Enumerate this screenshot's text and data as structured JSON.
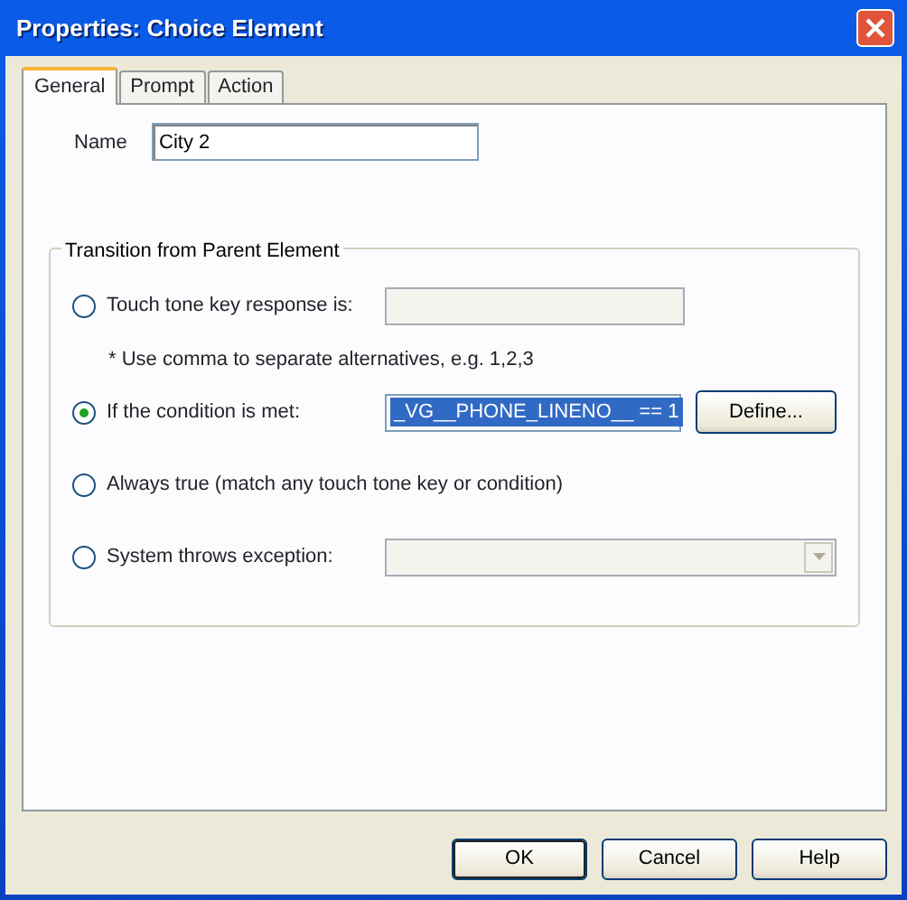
{
  "window": {
    "title": "Properties: Choice Element"
  },
  "tabs": [
    {
      "label": "General",
      "selected": true
    },
    {
      "label": "Prompt",
      "selected": false
    },
    {
      "label": "Action",
      "selected": false
    }
  ],
  "name_field": {
    "label": "Name",
    "value": "City 2"
  },
  "transition_group": {
    "title": "Transition from Parent Element",
    "options": [
      {
        "kind": "text-field",
        "label": "Touch tone key response is:",
        "selected": false,
        "disabled": true,
        "note": "* Use comma to separate alternatives, e.g. 1,2,3"
      },
      {
        "kind": "condition",
        "label": "If the condition is met:",
        "selected": true,
        "value": "_VG__PHONE_LINENO__ == 1",
        "button": "Define..."
      },
      {
        "kind": "plain",
        "label": "Always true (match any touch tone key or condition)",
        "selected": false
      },
      {
        "kind": "dropdown",
        "label": "System throws exception:",
        "selected": false,
        "disabled": true
      }
    ]
  },
  "buttons": [
    {
      "label": "OK",
      "default": true
    },
    {
      "label": "Cancel",
      "default": false
    },
    {
      "label": "Help",
      "default": false
    }
  ]
}
